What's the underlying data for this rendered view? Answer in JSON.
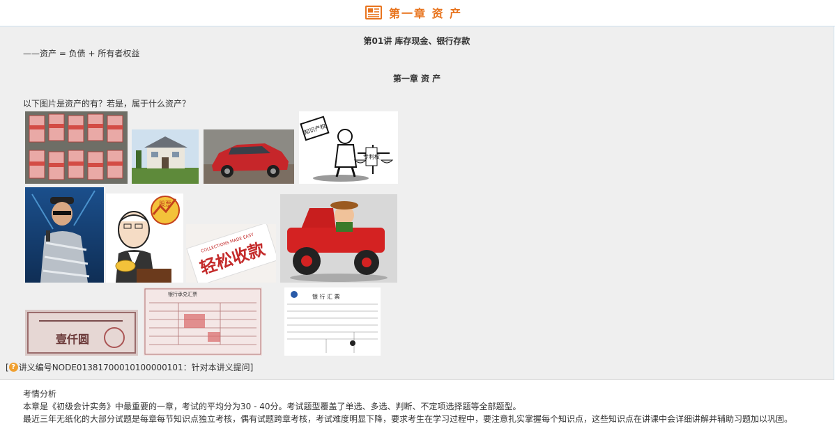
{
  "header": {
    "title": "第一章  资  产",
    "icon": "book-icon"
  },
  "lecture": {
    "title": "第01讲   库存现金、银行存款",
    "equation": "——资产 = 负债 + 所有者权益",
    "chapter_subtitle": "第一章  资  产",
    "question": "以下图片是资产的有？若是，属于什么资产？"
  },
  "images": [
    {
      "name": "cash-stacks-image"
    },
    {
      "name": "house-image"
    },
    {
      "name": "red-car-image"
    },
    {
      "name": "patent-rights-cartoon-image",
      "captions": [
        "知识产权",
        "专利权"
      ]
    },
    {
      "name": "performer-image"
    },
    {
      "name": "investor-cartoon-image",
      "caption": "股票"
    },
    {
      "name": "easy-collection-image",
      "caption": "轻松收款",
      "subcaption": "COLLECTIONS MADE EASY"
    },
    {
      "name": "tractor-cartoon-image"
    },
    {
      "name": "bond-certificate-image",
      "caption": "壹仟圆"
    },
    {
      "name": "acceptance-bill-image",
      "caption": "银行承兑汇票"
    },
    {
      "name": "bank-draft-image",
      "caption": "银 行 汇 票"
    }
  ],
  "note": {
    "prefix": "[",
    "text": "讲义编号NODE01381700010100000101：针对本讲义提问]"
  },
  "analysis": {
    "heading": "考情分析",
    "line1": "本章是《初级会计实务》中最重要的一章，考试的平均分为30 - 40分。考试题型覆盖了单选、多选、判断、不定项选择题等全部题型。",
    "line2": "最近三年无纸化的大部分试题是每章每节知识点独立考核，偶有试题跨章考核，考试难度明显下降，要求考生在学习过程中，要注意扎实掌握每个知识点，这些知识点在讲课中会详细讲解并辅助习题加以巩固。"
  }
}
